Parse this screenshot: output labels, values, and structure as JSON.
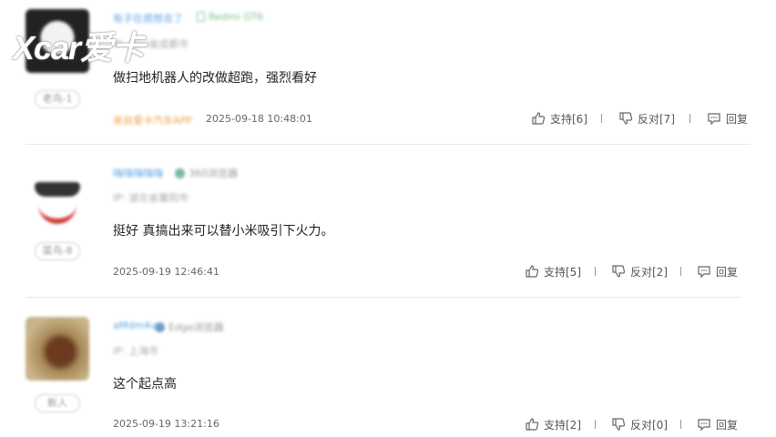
{
  "logo": {
    "text": "Xcar爱卡"
  },
  "comments": [
    {
      "username": "有子在感想去了",
      "device": "Redmi GT6",
      "ip": "IP: 四川省成都市",
      "badge": "老鸟-1",
      "text": "做扫地机器人的改做超跑，强烈看好",
      "source": "来自爱卡汽车APP",
      "time": "2025-09-18 10:48:01",
      "support": "支持[6]",
      "oppose": "反对[7]",
      "reply": "回复"
    },
    {
      "username": "嗨嗨嗨嗨嗨",
      "device": "360浏览器",
      "ip": "IP: 湖北省襄阳市",
      "badge": "菜鸟-8",
      "text": "挺好 真搞出来可以替小米吸引下火力。",
      "source": "",
      "time": "2025-09-19 12:46:41",
      "support": "支持[5]",
      "oppose": "反对[2]",
      "reply": "回复"
    },
    {
      "username": "aMdm4u",
      "device": "Edge浏览器",
      "ip": "IP: 上海市",
      "badge": "新人",
      "text": "这个起点高",
      "source": "",
      "time": "2025-09-19 13:21:16",
      "support": "支持[2]",
      "oppose": "反对[0]",
      "reply": "回复"
    }
  ],
  "icons": [
    "thumbs-up-icon",
    "thumbs-down-icon",
    "comment-icon",
    "phone-icon",
    "browser-icon"
  ]
}
